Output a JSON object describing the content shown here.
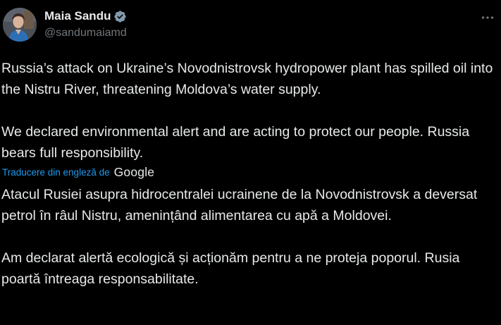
{
  "author": {
    "display_name": "Maia Sandu",
    "handle": "@sandumaiamd",
    "verified_icon": "verified-badge-icon",
    "avatar_icon": "profile-avatar"
  },
  "menu": {
    "icon": "more-options-icon"
  },
  "post": {
    "original_text": "Russia’s attack on Ukraine’s Novodnistrovsk hydropower plant has spilled oil into the Nistru River, threatening Moldova’s water supply.\n\nWe declared environmental alert and are acting to protect our people. Russia bears full responsibility.",
    "translation_label": "Traducere din engleză de",
    "translation_provider": "Google",
    "translated_text": "Atacul Rusiei asupra hidrocentralei ucrainene de la Novodnistrovsk a deversat petrol în râul Nistru, amenințând alimentarea cu apă a Moldovei.\n\nAm declarat alertă ecologică și acționăm pentru a ne proteja poporul. Rusia poartă întreaga responsabilitate."
  },
  "colors": {
    "background": "#000000",
    "text": "#e7e9ea",
    "secondary_text": "#71767b",
    "link": "#1d9bf0",
    "verified_badge": "#829aab"
  }
}
